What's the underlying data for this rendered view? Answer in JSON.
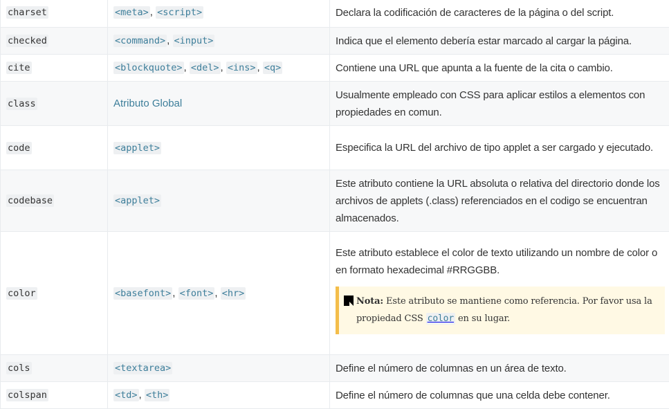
{
  "rows": [
    {
      "attribute": "charset",
      "elements": [
        "<meta>",
        "<script>"
      ],
      "description": "Declara la codificación de caracteres de la página o del script."
    },
    {
      "attribute": "checked",
      "elements": [
        "<command>",
        "<input>"
      ],
      "description": "Indica que el elemento debería estar marcado al cargar la página."
    },
    {
      "attribute": "cite",
      "elements": [
        "<blockquote>",
        "<del>",
        "<ins>",
        "<q>"
      ],
      "description": "Contiene una URL que apunta a la fuente de la cita o cambio."
    },
    {
      "attribute": "class",
      "elements_text": "Atributo Global",
      "description": "Usualmente empleado con CSS para aplicar estilos a elementos con propiedades en comun."
    },
    {
      "attribute": "code",
      "elements": [
        "<applet>"
      ],
      "description": "Especifica la URL del archivo de tipo applet a ser cargado y ejecutado."
    },
    {
      "attribute": "codebase",
      "elements": [
        "<applet>"
      ],
      "description": "Este atributo contiene la URL absoluta o relativa del directorio donde los archivos de applets (.class) referenciados en el codigo se encuentran almacenados."
    },
    {
      "attribute": "color",
      "elements": [
        "<basefont>",
        "<font>",
        "<hr>"
      ],
      "description": "Este atributo establece el color de texto utilizando un nombre de color o en formato hexadecimal #RRGGBB.",
      "note": {
        "label": "Nota:",
        "text_before": "Este atributo se mantiene como referencia. Por favor usa la propiedad CSS",
        "code": "color",
        "text_after": "en su lugar."
      }
    },
    {
      "attribute": "cols",
      "elements": [
        "<textarea>"
      ],
      "description": "Define el número de columnas en un área de texto."
    },
    {
      "attribute": "colspan",
      "elements": [
        "<td>",
        "<th>"
      ],
      "description": "Define el número de columnas que una celda debe contener."
    }
  ],
  "separator": ", "
}
